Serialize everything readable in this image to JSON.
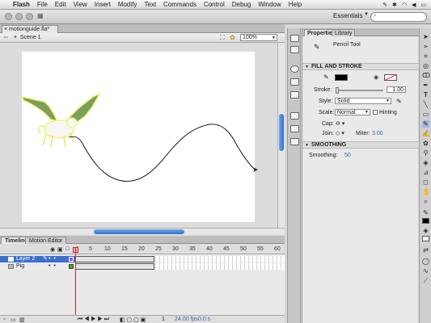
{
  "menubar": {
    "app": "Flash",
    "items": [
      "File",
      "Edit",
      "View",
      "Insert",
      "Modify",
      "Text",
      "Commands",
      "Control",
      "Debug",
      "Window",
      "Help"
    ]
  },
  "appbar": {
    "workspace": "Essentials"
  },
  "document": {
    "tab": "motionguide.fla*",
    "scene": "Scene 1",
    "zoom": "100%"
  },
  "timeline": {
    "tabs": [
      "Timeline",
      "Motion Editor"
    ],
    "frame_numbers": [
      "1",
      "5",
      "10",
      "15",
      "20",
      "25",
      "30",
      "35",
      "40",
      "45",
      "50",
      "55",
      "60"
    ],
    "layers": [
      {
        "name": "Layer 2",
        "selected": true,
        "color": "#8a5cf0"
      },
      {
        "name": "Pig",
        "selected": false,
        "color": "#2fb32f"
      }
    ],
    "footer": {
      "frame": "1",
      "fps": "24.00 fps",
      "time": "0.0 s"
    }
  },
  "properties": {
    "tabs": [
      "Properties",
      "Library"
    ],
    "tool_name": "Pencil Tool",
    "fill_stroke_header": "FILL AND STROKE",
    "stroke_label": "Stroke:",
    "stroke_value": "1.00",
    "style_label": "Style:",
    "style_value": "Solid",
    "scale_label": "Scale:",
    "scale_value": "Normal",
    "hinting_label": "Hinting",
    "cap_label": "Cap:",
    "join_label": "Join:",
    "miter_label": "Miter:",
    "miter_value": "3.00",
    "smoothing_header": "SMOOTHING",
    "smoothing_label": "Smoothing:",
    "smoothing_value": "50"
  },
  "colors": {
    "stroke": "#000000",
    "selection": "#3d6fcf",
    "pig": "#7aa05a",
    "outline": "#f2f27a"
  }
}
